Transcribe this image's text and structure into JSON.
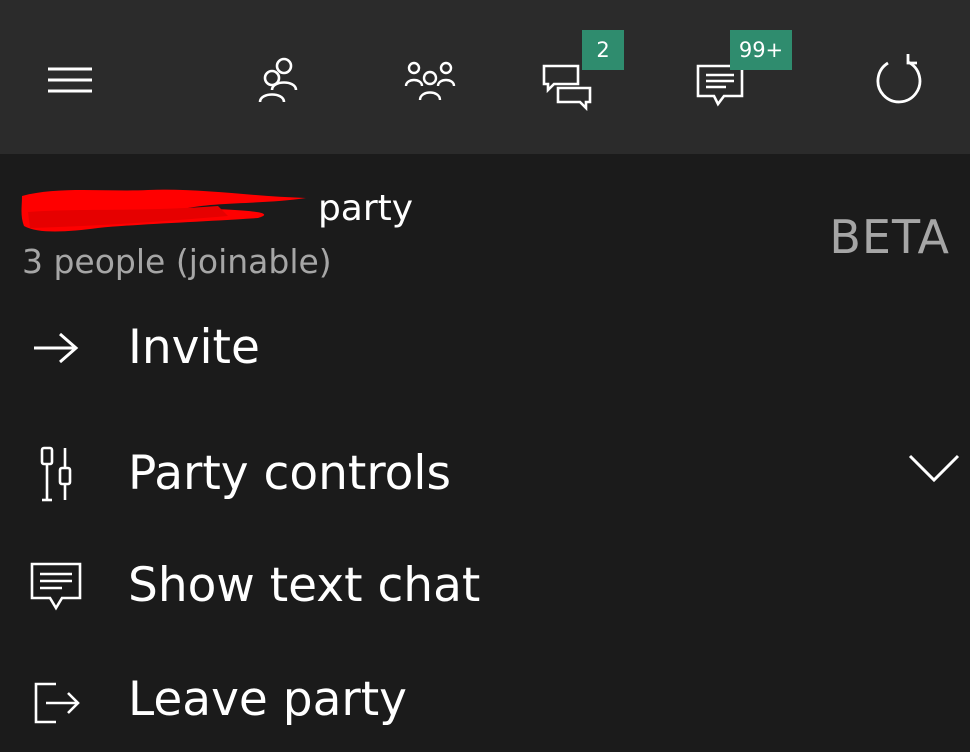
{
  "topbar": {
    "menu_icon": "hamburger-icon",
    "friends_icon": "friends-icon",
    "party_icon": "party-icon",
    "messages_icon": "messages-icon",
    "messages_badge": "2",
    "notifications_icon": "notifications-icon",
    "notifications_badge": "99+",
    "refresh_icon": "refresh-icon",
    "badge_color": "#2f8c6e"
  },
  "party": {
    "title_suffix": "party",
    "subtitle": "3 people (joinable)",
    "beta_label": "BETA"
  },
  "menu": {
    "items": [
      {
        "label": "Invite",
        "icon": "arrow-right-icon"
      },
      {
        "label": "Party controls",
        "icon": "party-controls-icon",
        "expand_icon": "chevron-down-icon"
      },
      {
        "label": "Show text chat",
        "icon": "text-chat-icon"
      },
      {
        "label": "Leave party",
        "icon": "leave-icon"
      }
    ]
  }
}
